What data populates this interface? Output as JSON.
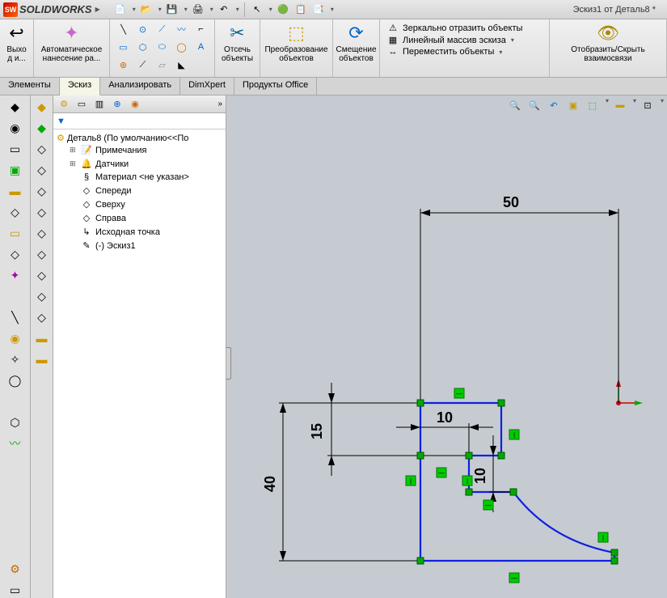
{
  "app": {
    "name": "SOLIDWORKS",
    "doc_title": "Эскиз1 от Деталь8 *"
  },
  "ribbon": {
    "exit": "Выхо\nд и...",
    "autodim": "Автоматическое\nнанесение ра...",
    "trim": "Отсечь\nобъекты",
    "convert": "Преобразование\nобъектов",
    "offset": "Смещение\nобъектов",
    "mirror": "Зеркально отразить объекты",
    "pattern": "Линейный массив эскиза",
    "move": "Переместить объекты",
    "showhide": "Отобразить/Скрыть\nвзаимосвязи"
  },
  "tabs": {
    "t1": "Элементы",
    "t2": "Эскиз",
    "t3": "Анализировать",
    "t4": "DimXpert",
    "t5": "Продукты Office"
  },
  "tree": {
    "root": "Деталь8  (По умолчанию<<По",
    "items": [
      {
        "icon": "📝",
        "label": "Примечания",
        "exp": "+"
      },
      {
        "icon": "🔔",
        "label": "Датчики",
        "exp": "+"
      },
      {
        "icon": "§",
        "label": "Материал <не указан>",
        "exp": ""
      },
      {
        "icon": "◇",
        "label": "Спереди",
        "exp": ""
      },
      {
        "icon": "◇",
        "label": "Сверху",
        "exp": ""
      },
      {
        "icon": "◇",
        "label": "Справа",
        "exp": ""
      },
      {
        "icon": "↳",
        "label": "Исходная точка",
        "exp": ""
      },
      {
        "icon": "✎",
        "label": "(-) Эскиз1",
        "exp": ""
      }
    ]
  },
  "dims": {
    "d50": "50",
    "d40": "40",
    "d15": "15",
    "d10a": "10",
    "d10b": "10"
  }
}
